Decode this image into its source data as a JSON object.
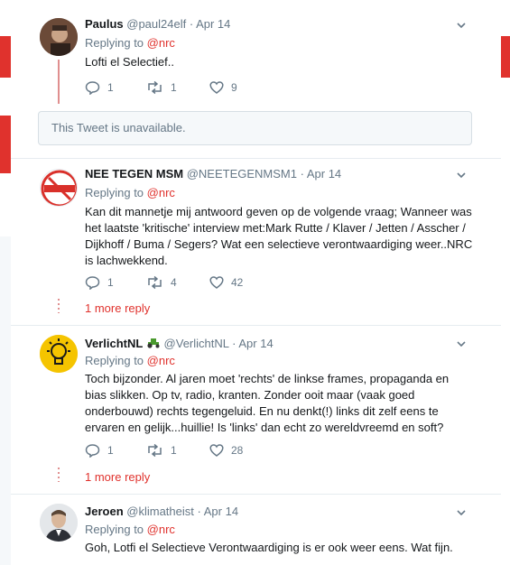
{
  "tweets": [
    {
      "name": "Paulus",
      "handle": "@paul24elf",
      "date": "Apr 14",
      "replying_label": "Replying to",
      "mention": "@nrc",
      "text": "Lofti el Selectief..",
      "replies": "1",
      "retweets": "1",
      "likes": "9"
    },
    {
      "name": "NEE TEGEN MSM",
      "handle": "@NEETEGENMSM1",
      "date": "Apr 14",
      "replying_label": "Replying to",
      "mention": "@nrc",
      "text": "Kan dit mannetje mij antwoord geven op de volgende vraag; Wanneer was het laatste 'kritische' interview met:Mark Rutte / Klaver / Jetten / Asscher / Dijkhoff / Buma / Segers? Wat een selectieve verontwaardiging weer..NRC is lachwekkend.",
      "replies": "1",
      "retweets": "4",
      "likes": "42",
      "more_replies": "1 more reply"
    },
    {
      "name": "VerlichtNL",
      "handle": "@VerlichtNL",
      "date": "Apr 14",
      "replying_label": "Replying to",
      "mention": "@nrc",
      "text": "Toch bijzonder. Al jaren moet 'rechts' de linkse frames, propaganda en bias slikken. Op tv, radio, kranten. Zonder ooit maar (vaak goed onderbouwd) rechts tegengeluid. En nu denkt(!) links dit zelf eens te ervaren en gelijk...huillie! Is 'links' dan echt zo wereldvreemd en soft?",
      "replies": "1",
      "retweets": "1",
      "likes": "28",
      "more_replies": "1 more reply"
    },
    {
      "name": "Jeroen",
      "handle": "@klimatheist",
      "date": "Apr 14",
      "replying_label": "Replying to",
      "mention": "@nrc",
      "text": "Goh, Lotfi el Selectieve Verontwaardiging is er ook weer eens. Wat fijn."
    }
  ],
  "unavailable_text": "This Tweet is unavailable.",
  "avatar_badge_text": "NEE TEGEN MAINSTREAM MEDIA",
  "colors": {
    "accent": "#e0322d",
    "muted": "#657786",
    "text": "#14171a",
    "separator": "#e6ecf0"
  },
  "icons": [
    "reply-icon",
    "retweet-icon",
    "like-icon",
    "caret-down-icon",
    "tractor-icon",
    "lightbulb-icon"
  ]
}
